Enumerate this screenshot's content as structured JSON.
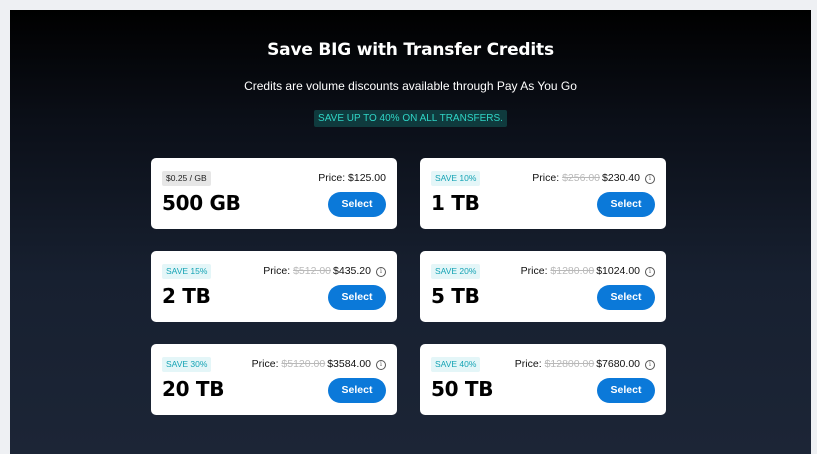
{
  "header": {
    "title": "Save BIG with Transfer Credits",
    "subtitle": "Credits are volume discounts available through Pay As You Go",
    "promo": "SAVE UP TO 40% ON ALL TRANSFERS."
  },
  "colors": {
    "accent": "#0b79d9",
    "promo_text": "#2fd5c6",
    "badge_teal": "#14a3b4"
  },
  "cards": [
    {
      "badge": "$0.25 / GB",
      "price_label": "Price:",
      "original_price": "",
      "price": "$125.00",
      "size": "500 GB",
      "button": "Select"
    },
    {
      "badge": "SAVE 10%",
      "price_label": "Price:",
      "original_price": "$256.00",
      "price": "$230.40",
      "size": "1 TB",
      "button": "Select"
    },
    {
      "badge": "SAVE 15%",
      "price_label": "Price:",
      "original_price": "$512.00",
      "price": "$435.20",
      "size": "2 TB",
      "button": "Select"
    },
    {
      "badge": "SAVE 20%",
      "price_label": "Price:",
      "original_price": "$1280.00",
      "price": "$1024.00",
      "size": "5 TB",
      "button": "Select"
    },
    {
      "badge": "SAVE 30%",
      "price_label": "Price:",
      "original_price": "$5120.00",
      "price": "$3584.00",
      "size": "20 TB",
      "button": "Select"
    },
    {
      "badge": "SAVE 40%",
      "price_label": "Price:",
      "original_price": "$12800.00",
      "price": "$7680.00",
      "size": "50 TB",
      "button": "Select"
    }
  ]
}
